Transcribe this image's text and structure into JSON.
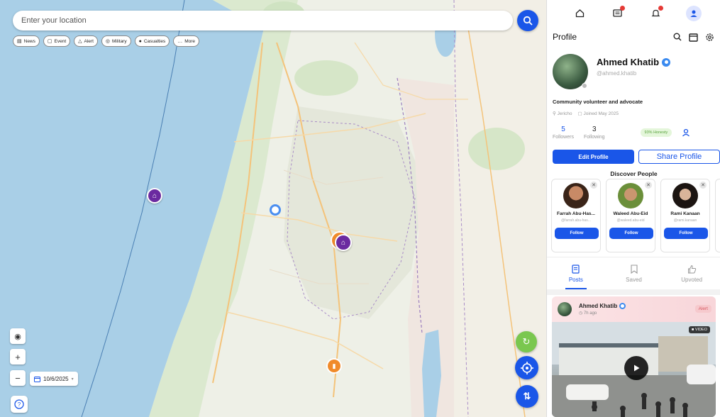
{
  "search": {
    "placeholder": "Enter your location"
  },
  "filters": [
    {
      "label": "News",
      "icon": "newspaper-icon"
    },
    {
      "label": "Event",
      "icon": "calendar-icon"
    },
    {
      "label": "Alert",
      "icon": "warning-icon"
    },
    {
      "label": "Military",
      "icon": "shield-icon"
    },
    {
      "label": "Casualties",
      "icon": "casualty-icon"
    },
    {
      "label": "More",
      "icon": "ellipsis-icon"
    }
  ],
  "map_controls": {
    "date": "10/6/2025"
  },
  "panel": {
    "nav": [
      "home-icon",
      "news-feed-icon",
      "notifications-icon",
      "profile-icon"
    ],
    "header_title": "Profile",
    "user": {
      "name": "Ahmed Khatib",
      "handle": "@ahmed.khatib",
      "bio": "Community volunteer and advocate",
      "location": "Jericho",
      "joined": "Joined May 2025"
    },
    "stats": {
      "followers_count": "5",
      "followers_label": "Followers",
      "following_count": "3",
      "following_label": "Following",
      "status": "93% Honesty"
    },
    "buttons": {
      "edit": "Edit Profile",
      "share": "Share Profile"
    },
    "discover_title": "Discover People",
    "people": [
      {
        "name": "Farrah Abu-Has...",
        "handle": "@farrah.abu-has...",
        "follow": "Follow"
      },
      {
        "name": "Waleed Abu-Eid",
        "handle": "@waleed.abu-eid",
        "follow": "Follow"
      },
      {
        "name": "Rami Kanaan",
        "handle": "@rami.kanaan",
        "follow": "Follow"
      }
    ],
    "tabs": [
      "Posts",
      "Saved",
      "Upvoted"
    ],
    "post": {
      "author": "Ahmed Khatib",
      "time": "7h ago",
      "tag": "Alert",
      "media_tag": "VIDEO"
    }
  },
  "colors": {
    "accent": "#1a56e8",
    "marker_purple": "#6b2aa0",
    "marker_orange": "#f08a2a",
    "fab_green": "#7ac74f"
  }
}
